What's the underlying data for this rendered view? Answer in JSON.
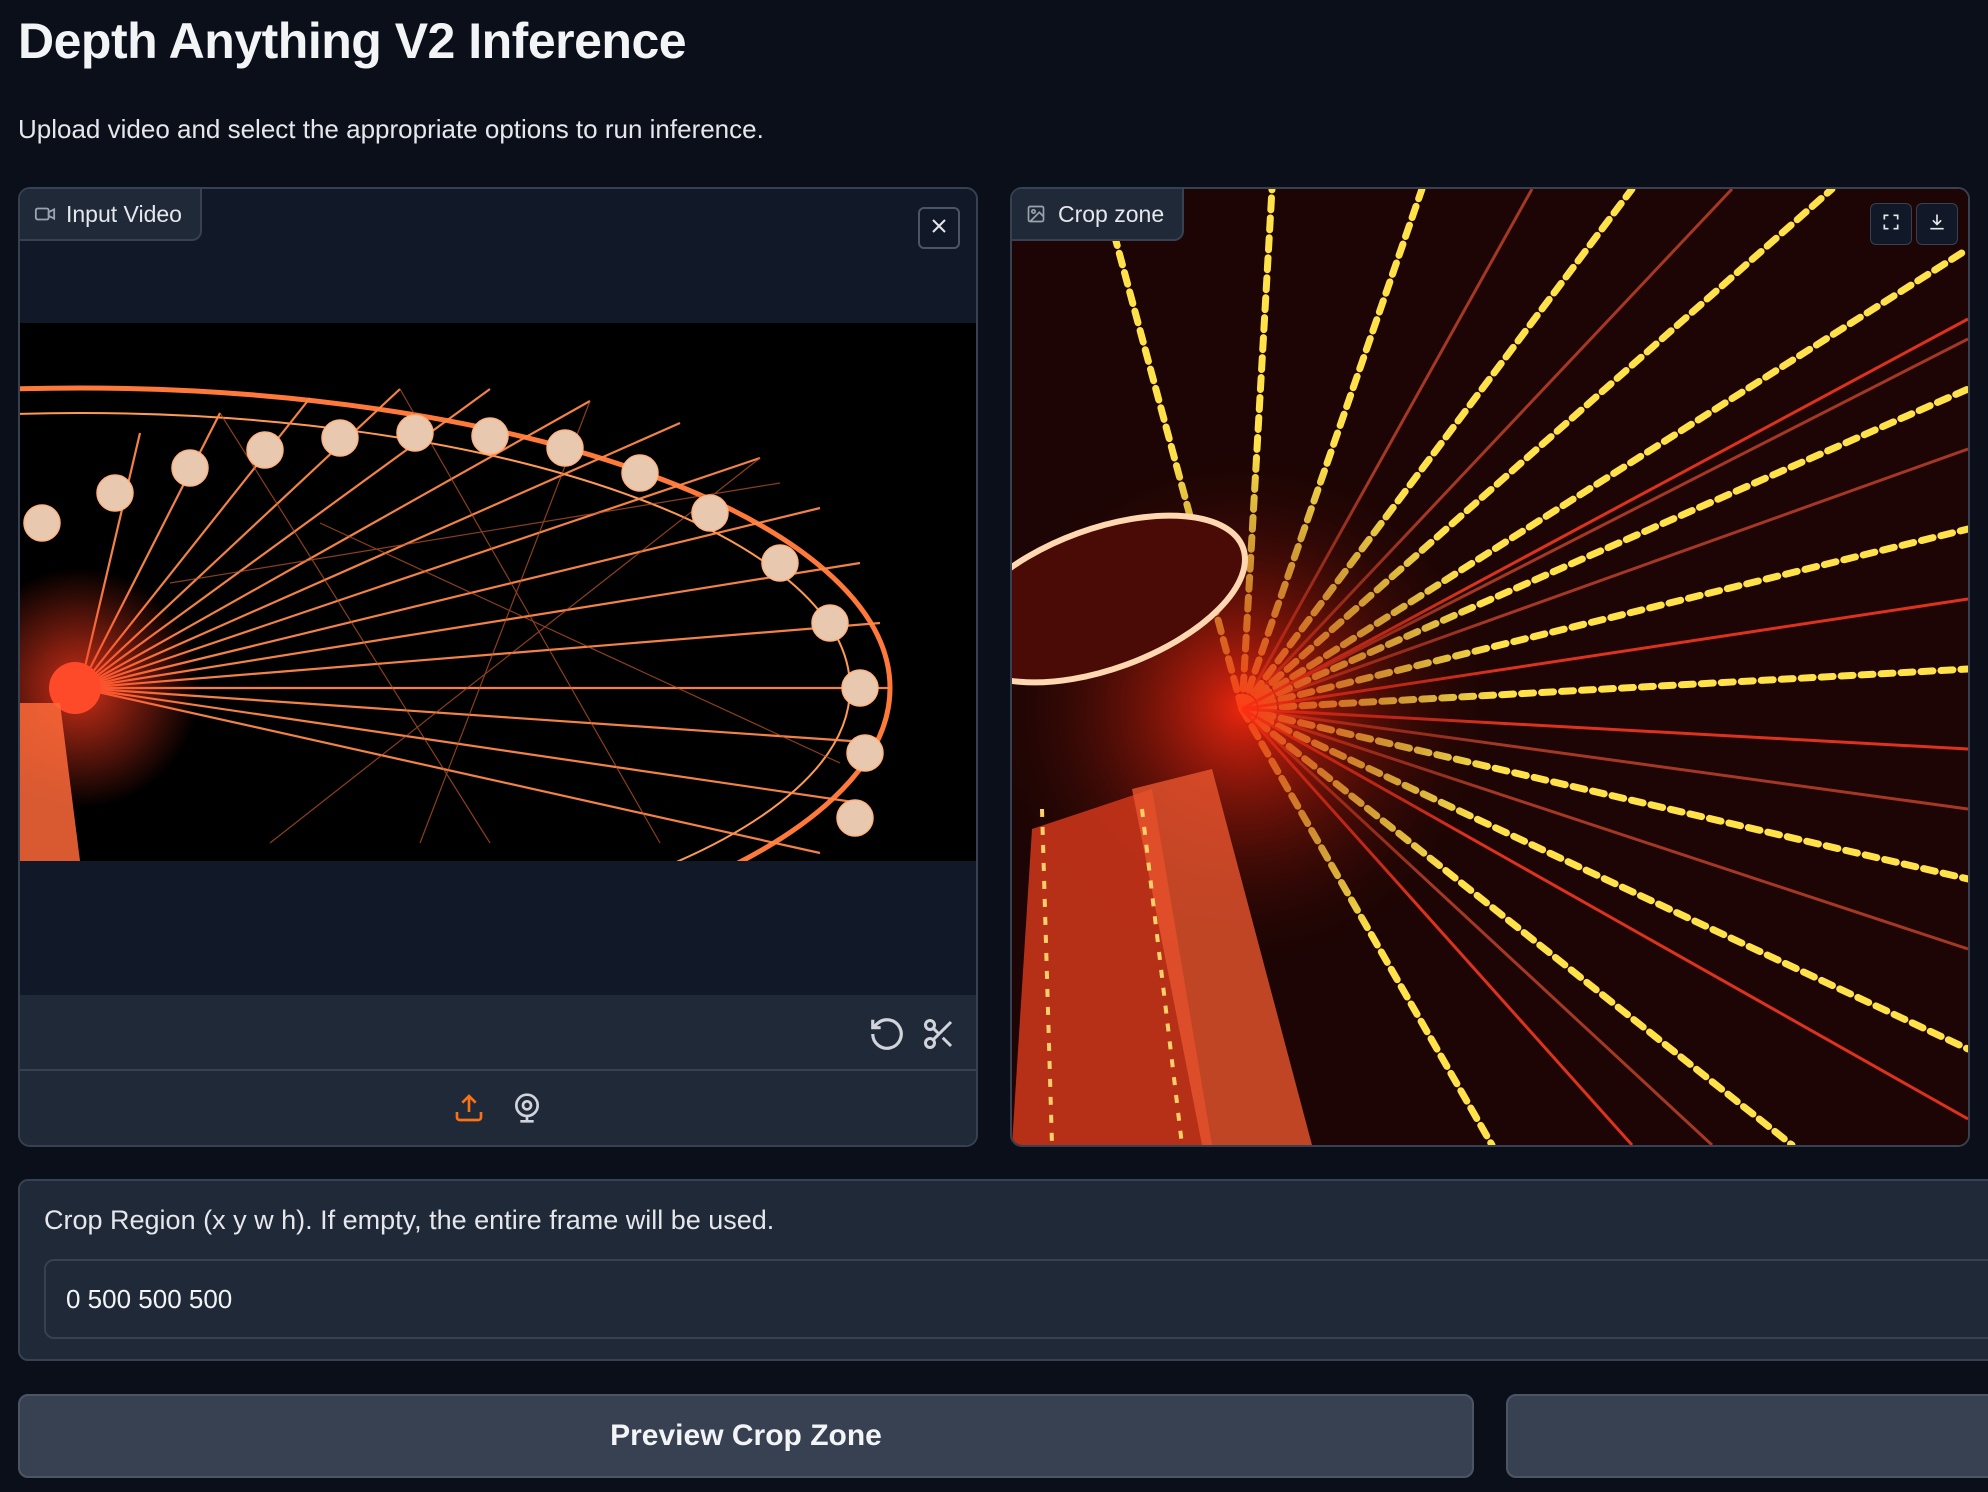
{
  "page": {
    "title": "Depth Anything V2 Inference",
    "description": "Upload video and select the appropriate options to run inference."
  },
  "video_input": {
    "label": "Input Video",
    "label_icon": "video-camera-icon",
    "close_icon": "close-icon",
    "edit_tools": [
      "undo-icon",
      "scissors-icon"
    ],
    "sources": [
      "upload-icon",
      "webcam-icon"
    ],
    "accent_color": "#f97316"
  },
  "crop_preview": {
    "label": "Crop zone",
    "label_icon": "image-icon",
    "tools": [
      "fullscreen-icon",
      "download-icon"
    ]
  },
  "crop_region": {
    "label": "Crop Region (x y w h). If empty, the entire frame will be used.",
    "value": "0 500 500 500",
    "placeholder": ""
  },
  "actions": {
    "preview_label": "Preview Crop Zone",
    "run_label": ""
  },
  "colors": {
    "background": "#0b0f19",
    "panel": "#111827",
    "border": "#374151",
    "button": "#374151"
  }
}
